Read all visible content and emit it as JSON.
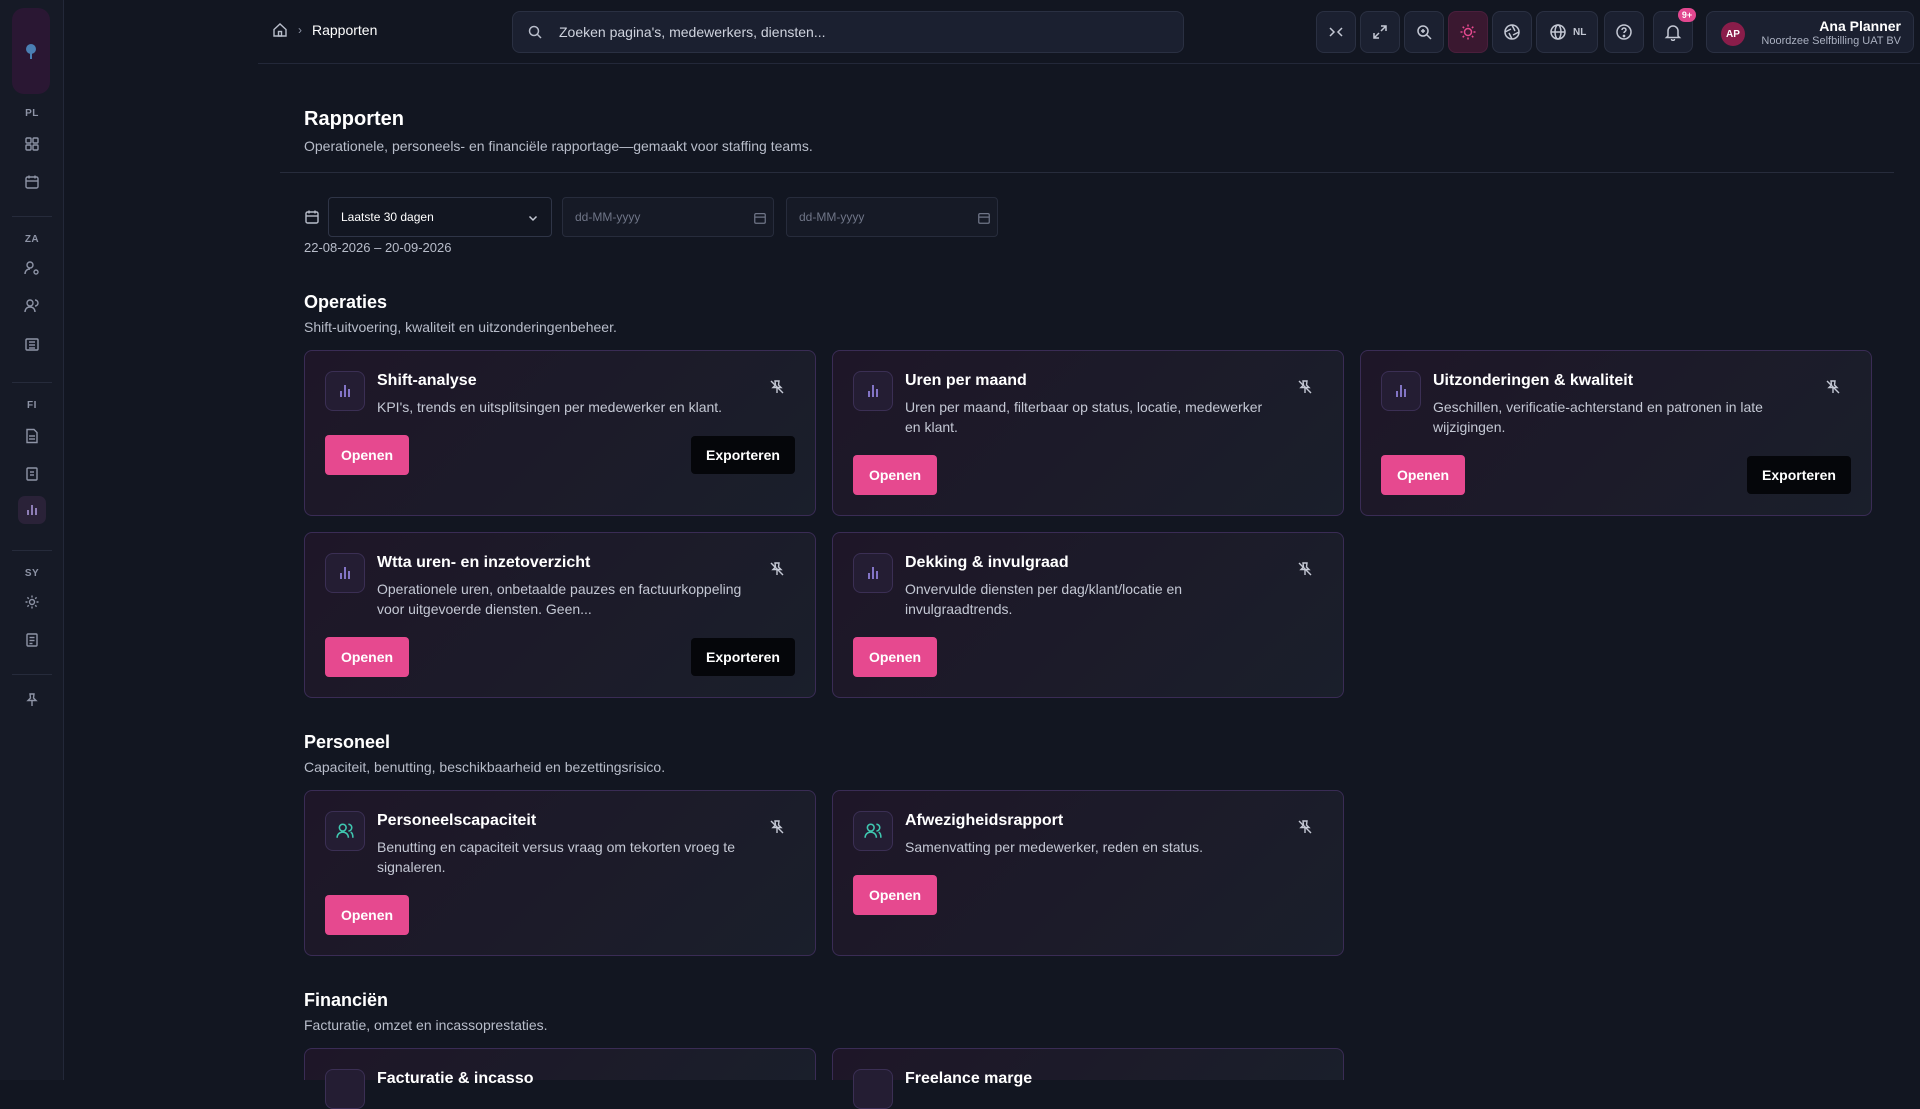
{
  "sidebar": {
    "sections": [
      "PL",
      "ZA",
      "FI",
      "SY"
    ]
  },
  "topbar": {
    "breadcrumb_current": "Rapporten",
    "search_placeholder": "Zoeken pagina's, medewerkers, diensten...",
    "language": "NL",
    "notifications_badge": "9+",
    "user": {
      "initials": "AP",
      "name": "Ana Planner",
      "org": "Noordzee Selfbilling UAT BV"
    }
  },
  "page": {
    "title": "Rapporten",
    "subtitle": "Operationele, personeels- en financiële rapportage—gemaakt voor staffing teams."
  },
  "filters": {
    "period": "Laatste 30 dagen",
    "date_from_placeholder": "dd-MM-yyyy",
    "date_to_placeholder": "dd-MM-yyyy",
    "range": "22-08-2026 – 20-09-2026"
  },
  "labels": {
    "open": "Openen",
    "export": "Exporteren"
  },
  "sections": [
    {
      "title": "Operaties",
      "subtitle": "Shift-uitvoering, kwaliteit en uitzonderingenbeheer.",
      "cards": [
        {
          "title": "Shift-analyse",
          "description": "KPI's, trends en uitsplitsingen per medewerker en klant."
        },
        {
          "title": "Uren per maand",
          "description": "Uren per maand, filterbaar op status, locatie, medewerker en klant."
        },
        {
          "title": "Uitzonderingen & kwaliteit",
          "description": "Geschillen, verificatie-achterstand en patronen in late wijzigingen."
        },
        {
          "title": "Wtta uren- en inzetoverzicht",
          "description": "Operationele uren, onbetaalde pauzes en factuurkoppeling voor uitgevoerde diensten. Geen..."
        },
        {
          "title": "Dekking & invulgraad",
          "description": "Onvervulde diensten per dag/klant/locatie en invulgraadtrends."
        }
      ]
    },
    {
      "title": "Personeel",
      "subtitle": "Capaciteit, benutting, beschikbaarheid en bezettingsrisico.",
      "cards": [
        {
          "title": "Personeelscapaciteit",
          "description": "Benutting en capaciteit versus vraag om tekorten vroeg te signaleren."
        },
        {
          "title": "Afwezigheidsrapport",
          "description": "Samenvatting per medewerker, reden en status."
        }
      ]
    },
    {
      "title": "Financiën",
      "subtitle": "Facturatie, omzet en incassoprestaties.",
      "cards": [
        {
          "title": "Facturatie & incasso",
          "description": ""
        },
        {
          "title": "Freelance marge",
          "description": ""
        }
      ]
    }
  ]
}
